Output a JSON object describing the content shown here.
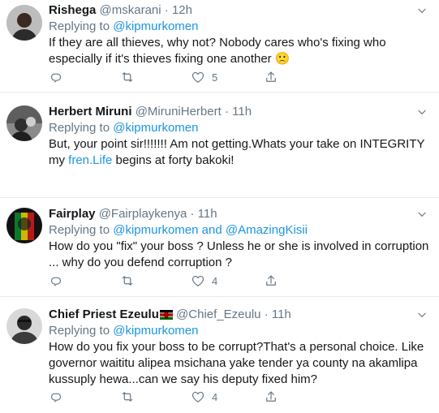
{
  "tweets": [
    {
      "name": "Rishega",
      "handle": "@mskarani",
      "separator": "·",
      "time": "12h",
      "replying_prefix": "Replying to ",
      "replying_to": "@kipmurkomen",
      "text_before": "If they are all thieves, why not? Nobody cares who's fixing who especially if it's thieves fixing one another ",
      "emoji": "🙁",
      "likes": "5"
    },
    {
      "name": "Herbert Miruni",
      "handle": "@MiruniHerbert",
      "separator": "·",
      "time": "11h",
      "replying_prefix": "Replying to ",
      "replying_to": "@kipmurkomen",
      "text_before": "But, your point sir!!!!!!! Am not getting.Whats your take on INTEGRITY my ",
      "text_link": "fren.Life",
      "text_after": " begins at forty bakoki!"
    },
    {
      "name": "Fairplay",
      "handle": "@Fairplaykenya",
      "separator": "·",
      "time": "11h",
      "replying_prefix": "Replying to ",
      "replying_to": "@kipmurkomen",
      "replying_joiner": " and ",
      "replying_to_2": "@AmazingKisii",
      "text_before": "How do you \"fix\" your boss ? Unless he or she is involved in corruption ...  why do you defend corruption ?",
      "likes": "4"
    },
    {
      "name": "Chief Priest Ezeulu",
      "handle": "@Chief_Ezeulu",
      "separator": "·",
      "time": "11h",
      "replying_prefix": "Replying to ",
      "replying_to": "@kipmurkomen",
      "text_before": "How do you fix your boss to be corrupt?That's a personal choice. Like governor waititu alipea msichana yake tender ya county na akamlipa kussuply hewa...can we say his deputy fixed him?",
      "likes": "4"
    }
  ],
  "icons": {
    "reply": "reply-icon",
    "retweet": "retweet-icon",
    "like": "like-icon",
    "share": "share-icon",
    "more": "chevron-down-icon",
    "flag": "kenya-flag-icon"
  },
  "colors": {
    "link": "#1b95e0",
    "secondary_text": "#657786",
    "divider": "#e6ecf0"
  }
}
